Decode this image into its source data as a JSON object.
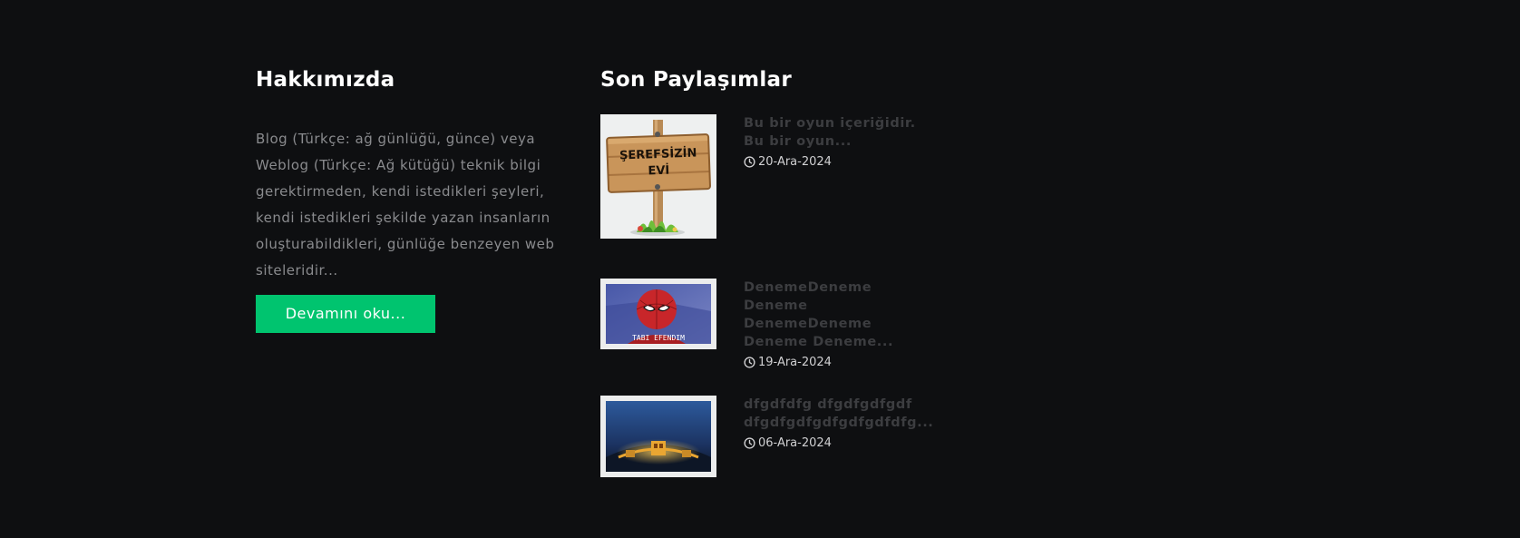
{
  "about": {
    "heading": "Hakkımızda",
    "text": "Blog (Türkçe: ağ günlüğü, günce) veya Weblog (Türkçe: Ağ kütüğü) teknik bilgi gerektirmeden, kendi istedikleri şeyleri, kendi istedikleri şekilde yazan insanların oluşturabildikleri, günlüğe benzeyen web siteleridir...",
    "button_label": "Devamını oku..."
  },
  "recent": {
    "heading": "Son Paylaşımlar",
    "posts": [
      {
        "title": "Bu bir oyun içeriğidir. Bu bir oyun...",
        "date": "20-Ara-2024",
        "sign_text_1": "ŞEREFSİZİN",
        "sign_text_2": "EVİ"
      },
      {
        "title": "DenemeDeneme Deneme DenemeDeneme Deneme Deneme...",
        "date": "19-Ara-2024",
        "caption": "TABI EFENDIM"
      },
      {
        "title": "dfgdfdfg dfgdfgdfgdf dfgdfgdfgdfgdfgdfdfg...",
        "date": "06-Ara-2024"
      }
    ]
  },
  "colors": {
    "background": "#0e0f11",
    "accent": "#00c46f",
    "muted": "#8a8b8e"
  }
}
